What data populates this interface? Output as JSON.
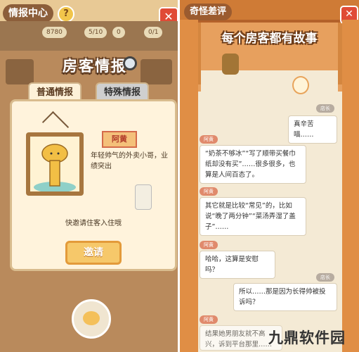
{
  "left_panel": {
    "title": "情报中心",
    "help_icon": "?",
    "close_icon": "✕",
    "stats": [
      "8780",
      "5/10",
      "0",
      "0/1"
    ],
    "heading": "房客情报",
    "tabs": [
      {
        "label": "普通情报",
        "active": true
      },
      {
        "label": "特殊情报",
        "active": false
      }
    ],
    "guest": {
      "name": "阿黄",
      "description": "年轻帅气的外卖小哥，业绩突出"
    },
    "invite_hint": "快邀请住客入住哦",
    "invite_button": "邀请"
  },
  "right_panel": {
    "title": "奇怪差评",
    "close_icon": "✕",
    "heading": "每个房客都有故事",
    "messages": [
      {
        "speaker": "店长",
        "side": "right",
        "text": "真辛苦喵……"
      },
      {
        "speaker": "阿黄",
        "side": "left",
        "text": "“奶茶不够冰”“写了顺带买餐巾纸却没有买”……很多很多，也算是人间百态了。"
      },
      {
        "speaker": "阿黄",
        "side": "left",
        "text": "其它就是比较“常见”的，比如说“晚了两分钟”“菜汤弄湿了盖子”……"
      },
      {
        "speaker": "阿黄",
        "side": "left",
        "text": "哈哈，这算是安慰吗？"
      },
      {
        "speaker": "店长",
        "side": "right",
        "text": "所以……那是因为长得帅被投诉吗？"
      },
      {
        "speaker": "阿黄",
        "side": "left",
        "text": "结果她男朋友就不高兴，诉到平台那里……"
      }
    ]
  },
  "watermark": "九鼎软件园",
  "colors": {
    "close_red": "#e04b36",
    "curtain_orange": "#e08e45",
    "invite_button": "#f6c86a"
  }
}
